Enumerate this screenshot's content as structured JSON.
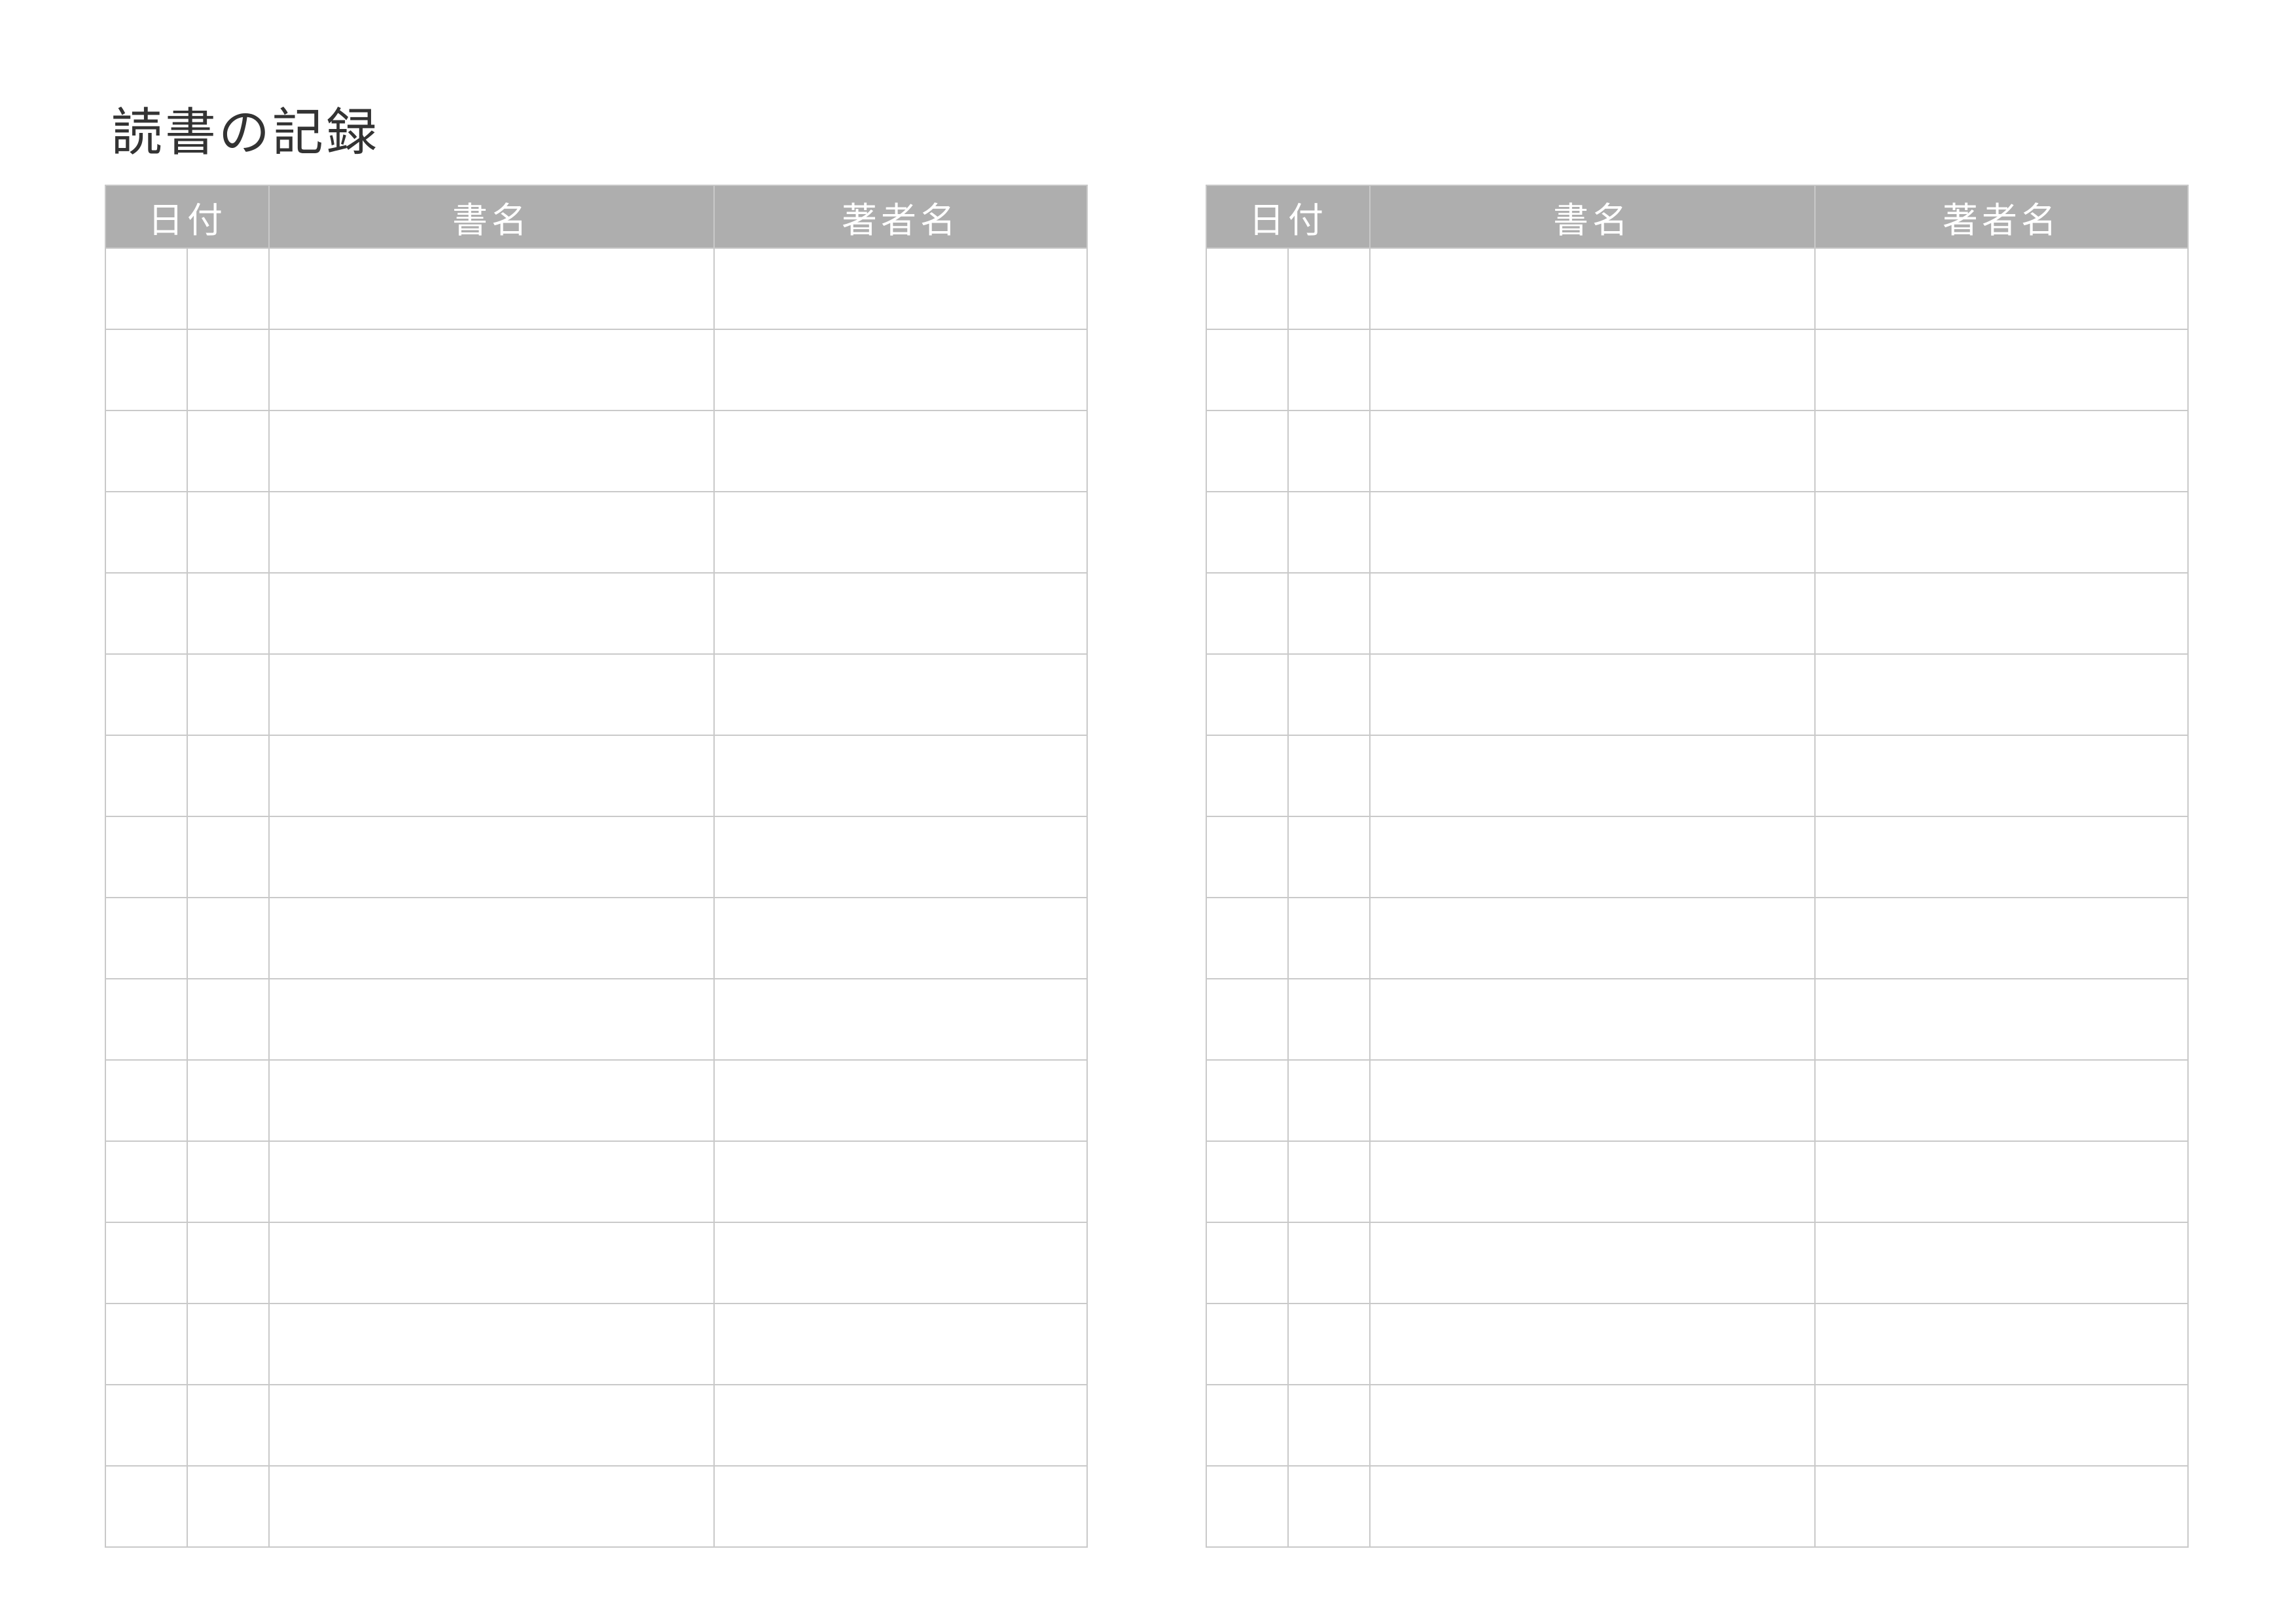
{
  "title": "読書の記録",
  "headers": {
    "date": "日付",
    "book_title": "書名",
    "author": "著者名"
  },
  "rows_per_table": 16,
  "table_count": 2
}
